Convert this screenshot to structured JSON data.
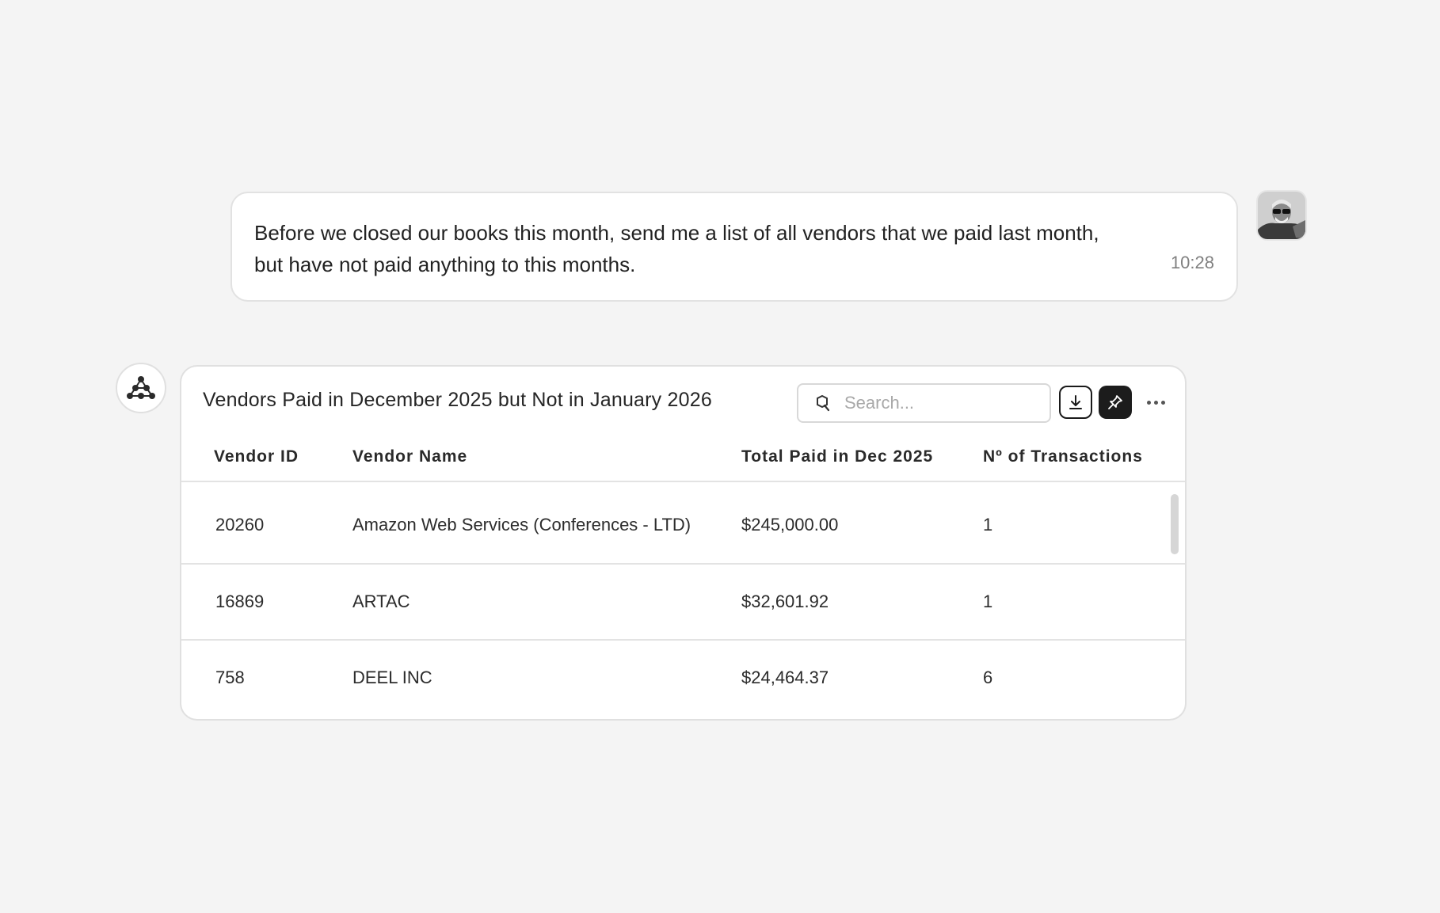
{
  "user_message": {
    "text_line1": "Before we closed our books this month, send me a list of all vendors that we paid last month,",
    "text_line2": "but have not paid anything to this months.",
    "time": "10:28",
    "avatar_icon": "user-photo-avatar"
  },
  "assistant": {
    "avatar_icon": "network-nodes-icon"
  },
  "card": {
    "title": "Vendors Paid in December 2025 but Not in January 2026",
    "search_placeholder": "Search...",
    "search_icon": "search-icon",
    "download_icon": "download-icon",
    "pin_icon": "pin-icon",
    "more_icon": "more-horizontal-icon"
  },
  "table": {
    "columns": [
      "Vendor ID",
      "Vendor Name",
      "Total Paid in Dec 2025",
      "Nº of Transactions"
    ],
    "rows": [
      [
        "20260",
        "Amazon Web Services (Conferences - LTD)",
        "$245,000.00",
        "1"
      ],
      [
        "16869",
        "ARTAC",
        "$32,601.92",
        "1"
      ],
      [
        "758",
        "DEEL INC",
        "$24,464.37",
        "6"
      ]
    ]
  },
  "colors": {
    "background": "#f4f4f4",
    "card": "#ffffff",
    "border": "#e0e0e0",
    "pin_button": "#1c1c1c"
  }
}
